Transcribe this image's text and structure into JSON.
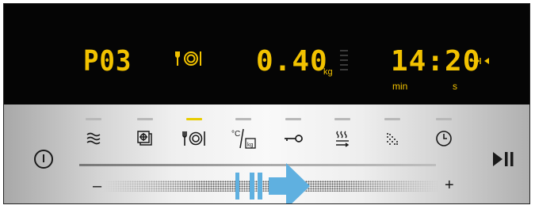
{
  "display": {
    "program_code": "P03",
    "weight_value": "0.40",
    "weight_unit": "kg",
    "time_value": "14:20",
    "time_unit_min": "min",
    "time_unit_s": "s",
    "active_mode_icon": "plate-icon",
    "end_time_icon": "end-time-icon"
  },
  "controls": {
    "power_icon": "power-icon",
    "start_pause_icon": "start-pause-icon",
    "slider_minus": "–",
    "slider_plus": "+",
    "mode_icons": [
      "microwave-waves-icon",
      "defrost-icon",
      "plate-icon",
      "temperature-weight-icon",
      "key-icon",
      "steam-icon",
      "dots-icon",
      "clock-icon"
    ],
    "weight_label": "kg",
    "temp_label": "°C"
  },
  "colors": {
    "display_bg": "#050505",
    "segment": "#f2c200",
    "active_indicator": "#e8cc00",
    "arrow": "#5fb0e0",
    "panel_mid": "#f9f9f9"
  }
}
